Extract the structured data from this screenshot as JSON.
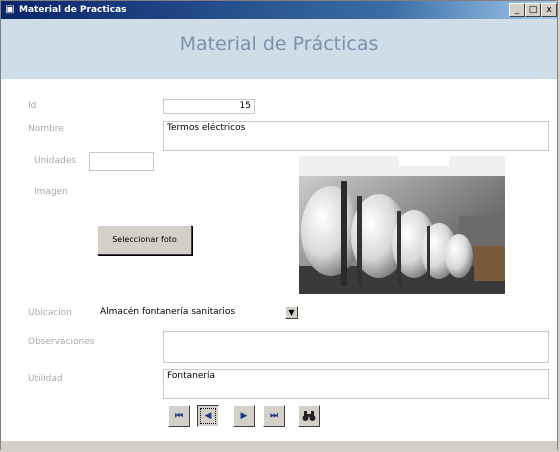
{
  "window": {
    "title": "Material de Practicas",
    "minimize_glyph": "_",
    "maximize_glyph": "□",
    "close_glyph": "x",
    "app_icon": "access-form-icon"
  },
  "header": {
    "title": "Material de Prácticas"
  },
  "form": {
    "id_label": "Id",
    "id_value": "15",
    "nombre_label": "Nombre",
    "nombre_value": "Termos eléctricos",
    "unidades_label": "Unidades",
    "unidades_value": "",
    "imagen_label": "Imagen",
    "select_file_label": "Seleccionar foto",
    "ubicacion_label": "Ubicacion",
    "ubicacion_value": "Almacén fontanería sanitarios",
    "observaciones_label": "Observaciones",
    "observaciones_value": "",
    "utilidad_label": "Utilidad",
    "utilidad_value": "Fontanería"
  },
  "navigation": {
    "first": "⏮",
    "prev": "◀",
    "next": "▶",
    "last": "⏭",
    "find_icon": "binoculars-icon"
  },
  "colors": {
    "titlebar": "#0a246a",
    "header_bg": "#cfdde8",
    "header_text": "#7a93ad",
    "label_text": "#a9a9a9"
  }
}
